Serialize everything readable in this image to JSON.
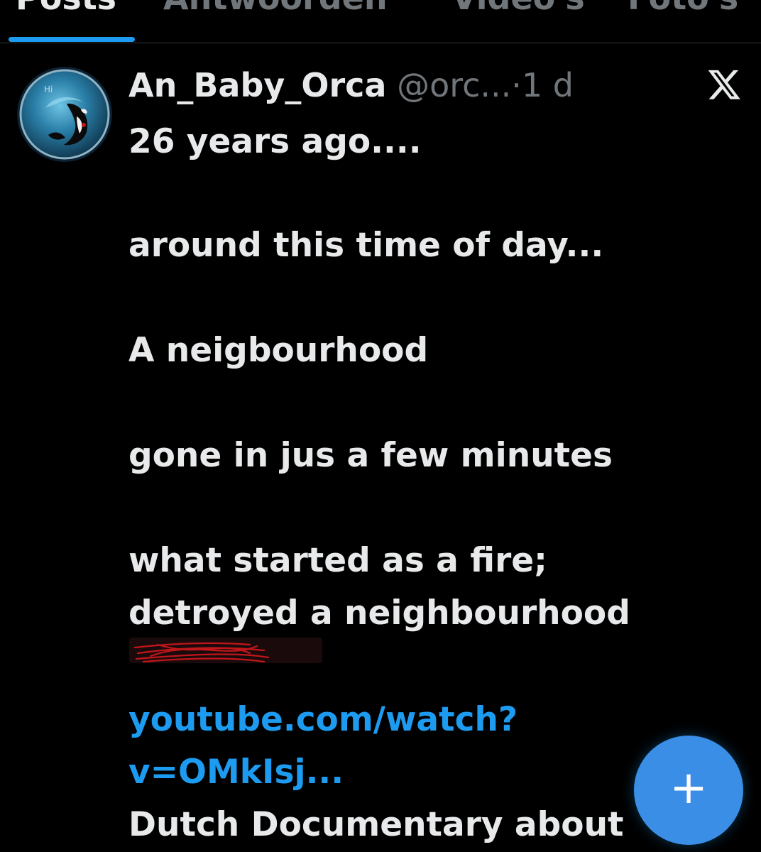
{
  "tabs": [
    {
      "label": "Posts",
      "active": true
    },
    {
      "label": "Antwoorden",
      "active": false
    },
    {
      "label": "Video's",
      "active": false
    },
    {
      "label": "Foto's",
      "active": false
    }
  ],
  "post": {
    "display_name": "An_Baby_Orca",
    "handle": "@orc...",
    "separator": "·",
    "time": "1 d",
    "avatar_text": "Hi",
    "lines": [
      "26 years ago....",
      "around this time of day...",
      "A neigbourhood",
      "gone in jus a few minutes",
      "what started as a fire;",
      "detroyed a neighbourhood"
    ],
    "link_line1": "youtube.com/watch?",
    "link_line2": "v=OMkIsj...",
    "last_line": "Dutch Documentary about"
  },
  "fab": {
    "label": "+"
  },
  "icons": {
    "x_logo": "x-logo-icon",
    "compose": "plus-icon"
  },
  "colors": {
    "background": "#000000",
    "text": "#e7e9ea",
    "muted": "#71767b",
    "accent": "#1d9bf0",
    "scribble": "#c0161a"
  }
}
